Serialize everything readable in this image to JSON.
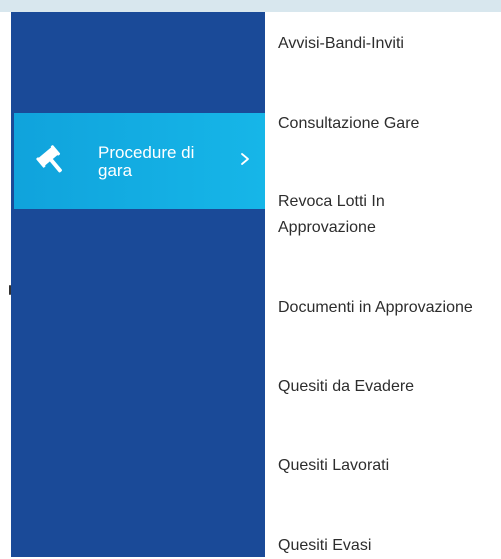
{
  "sidebar": {
    "active_item": {
      "label": "Procedure di gara",
      "icon": "gavel-icon",
      "color": "#16b6e8"
    },
    "background_color": "#1a4a98"
  },
  "submenu": {
    "items": [
      {
        "label": "Avvisi-Bandi-Inviti"
      },
      {
        "label": "Consultazione Gare"
      },
      {
        "label": "Revoca Lotti In Approvazione"
      },
      {
        "label": "Documenti in Approvazione"
      },
      {
        "label": "Quesiti da Evadere"
      },
      {
        "label": "Quesiti Lavorati"
      },
      {
        "label": "Quesiti Evasi"
      }
    ]
  }
}
